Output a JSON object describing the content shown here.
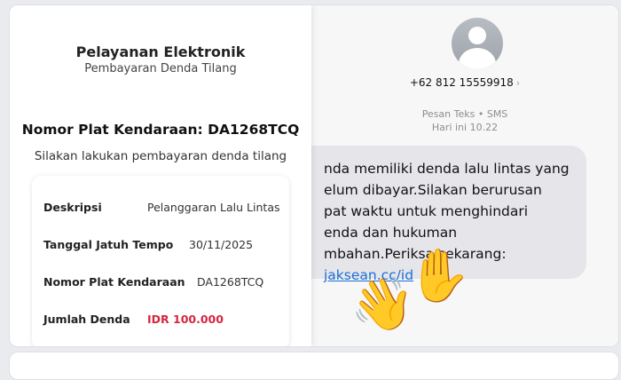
{
  "document": {
    "title": "Pelayanan Elektronik",
    "subtitle": "Pembayaran Denda Tilang",
    "plate_heading": "Nomor Plat Kendaraan: DA1268TCQ",
    "instruction": "Silakan lakukan pembayaran denda tilang",
    "details": [
      {
        "label": "Deskripsi",
        "value": "Pelanggaran Lalu Lintas"
      },
      {
        "label": "Tanggal Jatuh Tempo",
        "value": "30/11/2025"
      },
      {
        "label": "Nomor Plat Kendaraan",
        "value": "DA1268TCQ"
      },
      {
        "label": "Jumlah Denda",
        "value": "IDR 100.000"
      }
    ],
    "amount_color": "#d3273e"
  },
  "sms": {
    "contact_number": "+62 812 15559918",
    "message_type": "Pesan Teks • SMS",
    "timestamp": "Hari ini 10.22",
    "message_lines": [
      "nda memiliki denda lalu lintas yang",
      "elum dibayar.Silakan berurusan",
      "pat waktu untuk menghindari",
      "enda dan hukuman",
      "mbahan.Periksa sekarang:"
    ],
    "link": "jaksean.cc/id",
    "link_color": "#1a6fd8",
    "emoji": [
      "waving-hand",
      "raised-hand"
    ]
  }
}
